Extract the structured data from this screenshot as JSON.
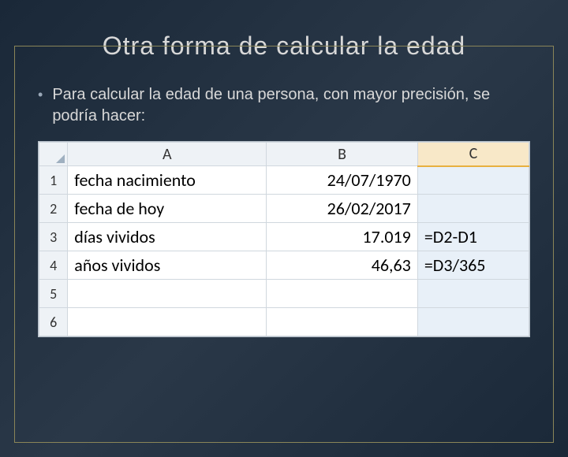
{
  "title": "Otra forma de calcular la edad",
  "bullet": "Para calcular la edad de una persona, con mayor precisión, se podría hacer:",
  "sheet": {
    "columns": {
      "A": "A",
      "B": "B",
      "C": "C"
    },
    "rows": [
      {
        "n": "1",
        "a": "fecha nacimiento",
        "b": "24/07/1970",
        "c": ""
      },
      {
        "n": "2",
        "a": "fecha de hoy",
        "b": "26/02/2017",
        "c": ""
      },
      {
        "n": "3",
        "a": "días vividos",
        "b": "17.019",
        "c": "=D2-D1"
      },
      {
        "n": "4",
        "a": "años vividos",
        "b": "46,63",
        "c": "=D3/365"
      },
      {
        "n": "5",
        "a": "",
        "b": "",
        "c": ""
      },
      {
        "n": "6",
        "a": "",
        "b": "",
        "c": ""
      }
    ]
  }
}
